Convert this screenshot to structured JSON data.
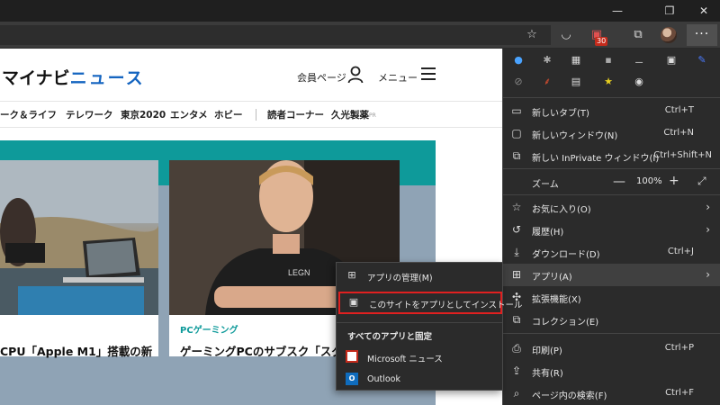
{
  "window": {
    "minimize_glyph": "—",
    "restore_glyph": "❐",
    "close_glyph": "✕"
  },
  "toolbar": {
    "download_badge": "30",
    "more_glyph": "···"
  },
  "site": {
    "logo_main": "マイナビ",
    "logo_news": "ニュース",
    "member_page": "会員ページ",
    "menu_label": "メニュー",
    "nav": [
      "ーク＆ライフ",
      "テレワーク",
      "東京2020",
      "エンタメ",
      "ホビー",
      "読者コーナー",
      "久光製薬"
    ],
    "nav_pr": "PR",
    "cards": [
      {
        "category": "",
        "title": "CPU「Apple M1」搭載の新"
      },
      {
        "category": "PCゲーミング",
        "title": "ゲーミングPCのサブスク「スグゲー」"
      }
    ]
  },
  "menu": {
    "new_tab": {
      "label": "新しいタブ(T)",
      "shortcut": "Ctrl+T"
    },
    "new_window": {
      "label": "新しいウィンドウ(N)",
      "shortcut": "Ctrl+N"
    },
    "new_private": {
      "label": "新しい InPrivate ウィンドウ(I)",
      "shortcut": "Ctrl+Shift+N"
    },
    "zoom": {
      "label": "ズーム",
      "minus": "—",
      "value": "100%",
      "plus": "+"
    },
    "favorites": {
      "label": "お気に入り(O)"
    },
    "history": {
      "label": "履歴(H)"
    },
    "downloads": {
      "label": "ダウンロード(D)",
      "shortcut": "Ctrl+J"
    },
    "apps": {
      "label": "アプリ(A)"
    },
    "extensions": {
      "label": "拡張機能(X)"
    },
    "collections": {
      "label": "コレクション(E)"
    },
    "print": {
      "label": "印刷(P)",
      "shortcut": "Ctrl+P"
    },
    "share": {
      "label": "共有(R)"
    },
    "find": {
      "label": "ページ内の検索(F)",
      "shortcut": "Ctrl+F"
    }
  },
  "apps_menu": {
    "manage": "アプリの管理(M)",
    "install": "このサイトをアプリとしてインストール",
    "section": "すべてのアプリと固定",
    "msn": "Microsoft ニュース",
    "outlook": "Outlook"
  },
  "colors": {
    "menu_bg": "#2b2b2b",
    "highlight_border": "#e02020",
    "accent_teal": "#0e9a9a",
    "news_blue": "#1565c0"
  }
}
